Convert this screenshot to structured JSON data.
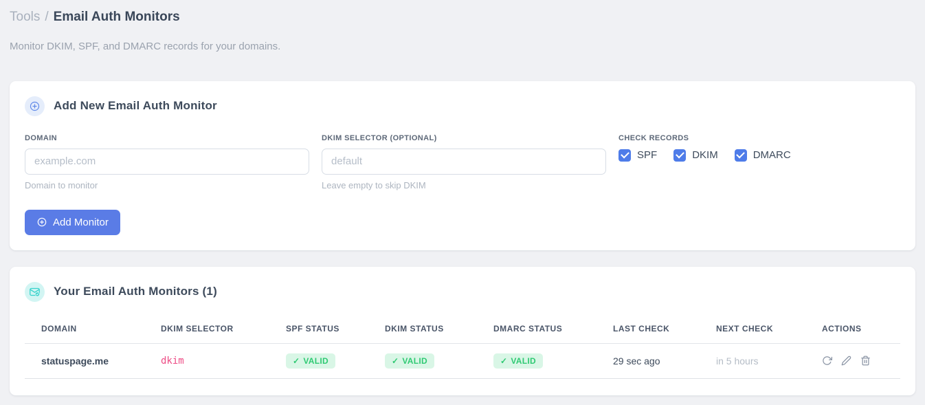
{
  "header": {
    "breadcrumb_parent": "Tools",
    "breadcrumb_separator": "/",
    "page_title": "Email Auth Monitors",
    "subtitle": "Monitor DKIM, SPF, and DMARC records for your domains."
  },
  "add_card": {
    "title": "Add New Email Auth Monitor",
    "icon_name": "plus-circle-icon",
    "domain_field": {
      "label": "DOMAIN",
      "placeholder": "example.com",
      "value": "",
      "helper": "Domain to monitor"
    },
    "dkim_field": {
      "label": "DKIM SELECTOR (OPTIONAL)",
      "placeholder": "default",
      "value": "",
      "helper": "Leave empty to skip DKIM"
    },
    "check_records": {
      "label": "CHECK RECORDS",
      "options": [
        {
          "label": "SPF",
          "checked": true
        },
        {
          "label": "DKIM",
          "checked": true
        },
        {
          "label": "DMARC",
          "checked": true
        }
      ]
    },
    "submit_button": "Add Monitor"
  },
  "monitors_card": {
    "title": "Your Email Auth Monitors (1)",
    "icon_name": "envelope-check-icon",
    "columns": [
      "DOMAIN",
      "DKIM SELECTOR",
      "SPF STATUS",
      "DKIM STATUS",
      "DMARC STATUS",
      "LAST CHECK",
      "NEXT CHECK",
      "ACTIONS"
    ],
    "rows": [
      {
        "domain": "statuspage.me",
        "dkim_selector": "dkim",
        "spf_status": "VALID",
        "dkim_status": "VALID",
        "dmarc_status": "VALID",
        "last_check": "29 sec ago",
        "next_check": "in 5 hours",
        "action_icons": [
          "refresh-icon",
          "edit-icon",
          "delete-icon"
        ]
      }
    ]
  },
  "icons": {
    "check_glyph": "✓"
  },
  "colors": {
    "accent_blue": "#4e7ce9",
    "button_blue": "#5a7ce6",
    "badge_green_bg": "#d9f6e6",
    "badge_green_text": "#2fca73",
    "code_pink": "#ed4c85",
    "teal": "#35d2cb",
    "page_background": "#f0f1f4"
  }
}
